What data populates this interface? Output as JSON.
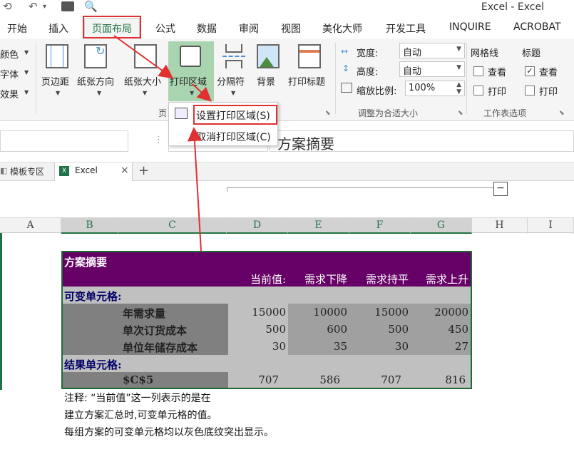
{
  "window": {
    "title": "Excel - Excel"
  },
  "tabs": [
    "开始",
    "插入",
    "页面布局",
    "公式",
    "数据",
    "审阅",
    "视图",
    "美化大师",
    "开发工具",
    "INQUIRE",
    "ACROBAT"
  ],
  "ribbon": {
    "left_cut": [
      "颜色",
      "字体",
      "效果"
    ],
    "buttons": {
      "margins": "页边距",
      "orientation": "纸张方向",
      "size": "纸张大小",
      "print_area": "打印区域",
      "breaks": "分隔符",
      "background": "背景",
      "print_titles": "打印标题"
    },
    "group_page_setup": "页",
    "scale": {
      "width_label": "宽度:",
      "width_value": "自动",
      "height_label": "高度:",
      "height_value": "自动",
      "scale_label": "缩放比例:",
      "scale_value": "100%",
      "group": "调整为合适大小"
    },
    "sheet_options": {
      "gridlines": "网格线",
      "headings": "标题",
      "view": "查看",
      "print": "打印",
      "group": "工作表选项"
    }
  },
  "menu": {
    "set_print_area": "设置打印区域(S)",
    "clear_print_area": "取消打印区域(C)"
  },
  "formula_bar": {
    "content": "方案摘要"
  },
  "doc_tabs": {
    "templates": "模板专区",
    "excel": "Excel",
    "close": "×",
    "add": "+"
  },
  "columns": [
    "A",
    "B",
    "C",
    "D",
    "E",
    "F",
    "G",
    "H",
    "I"
  ],
  "outline_button": "−",
  "table": {
    "title": "方案摘要",
    "headers": [
      "当前值:",
      "需求下降",
      "需求持平",
      "需求上升"
    ],
    "variable_label": "可变单元格:",
    "rows": [
      {
        "label": "年需求量",
        "values": [
          "15000",
          "10000",
          "15000",
          "20000"
        ]
      },
      {
        "label": "单次订货成本",
        "values": [
          "500",
          "600",
          "500",
          "450"
        ]
      },
      {
        "label": "单位年储存成本",
        "values": [
          "30",
          "35",
          "30",
          "27"
        ]
      }
    ],
    "result_label": "结果单元格:",
    "result_row": {
      "label": "$C$5",
      "values": [
        "707",
        "586",
        "707",
        "816"
      ]
    }
  },
  "notes": [
    "注释: “当前值”这一列表示的是在",
    "建立方案汇总时,可变单元格的值。",
    "每组方案的可变单元格均以灰色底纹突出显示。"
  ],
  "colors": {
    "accent": "#217346",
    "header_purple": "#660066",
    "annotation_red": "#e03030",
    "print_area_highlight": "#a9d4b0"
  }
}
